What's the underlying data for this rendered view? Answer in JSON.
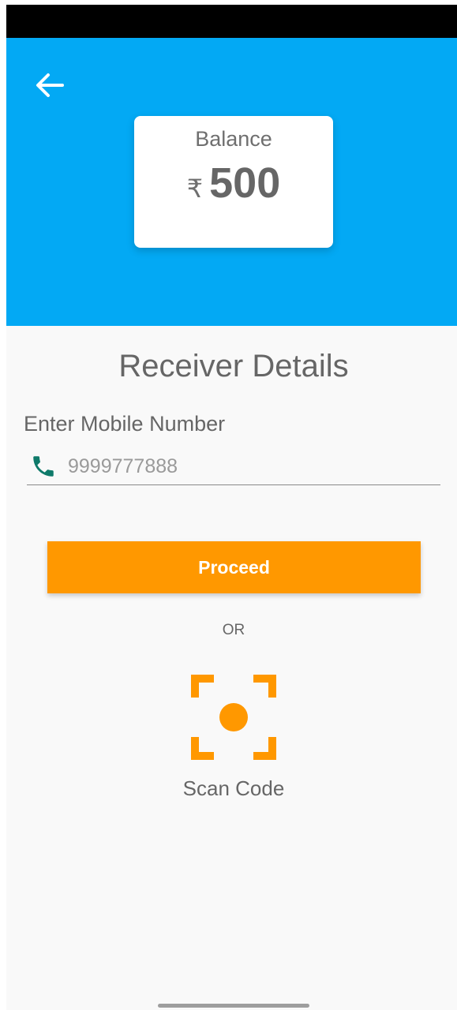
{
  "colors": {
    "header_bg": "#03a9f4",
    "accent": "#ff9800",
    "phone_icon": "#0f7a6a"
  },
  "header": {
    "back_icon": "arrow-left-icon"
  },
  "balance": {
    "label": "Balance",
    "currency": "₹",
    "amount": "500"
  },
  "receiver": {
    "title": "Receiver Details",
    "mobile_label": "Enter Mobile Number",
    "mobile_placeholder": "9999777888",
    "mobile_value": "",
    "phone_icon": "phone-icon"
  },
  "actions": {
    "proceed_label": "Proceed",
    "or_text": "OR",
    "scan_label": "Scan Code",
    "scan_icon": "scan-code-icon"
  }
}
